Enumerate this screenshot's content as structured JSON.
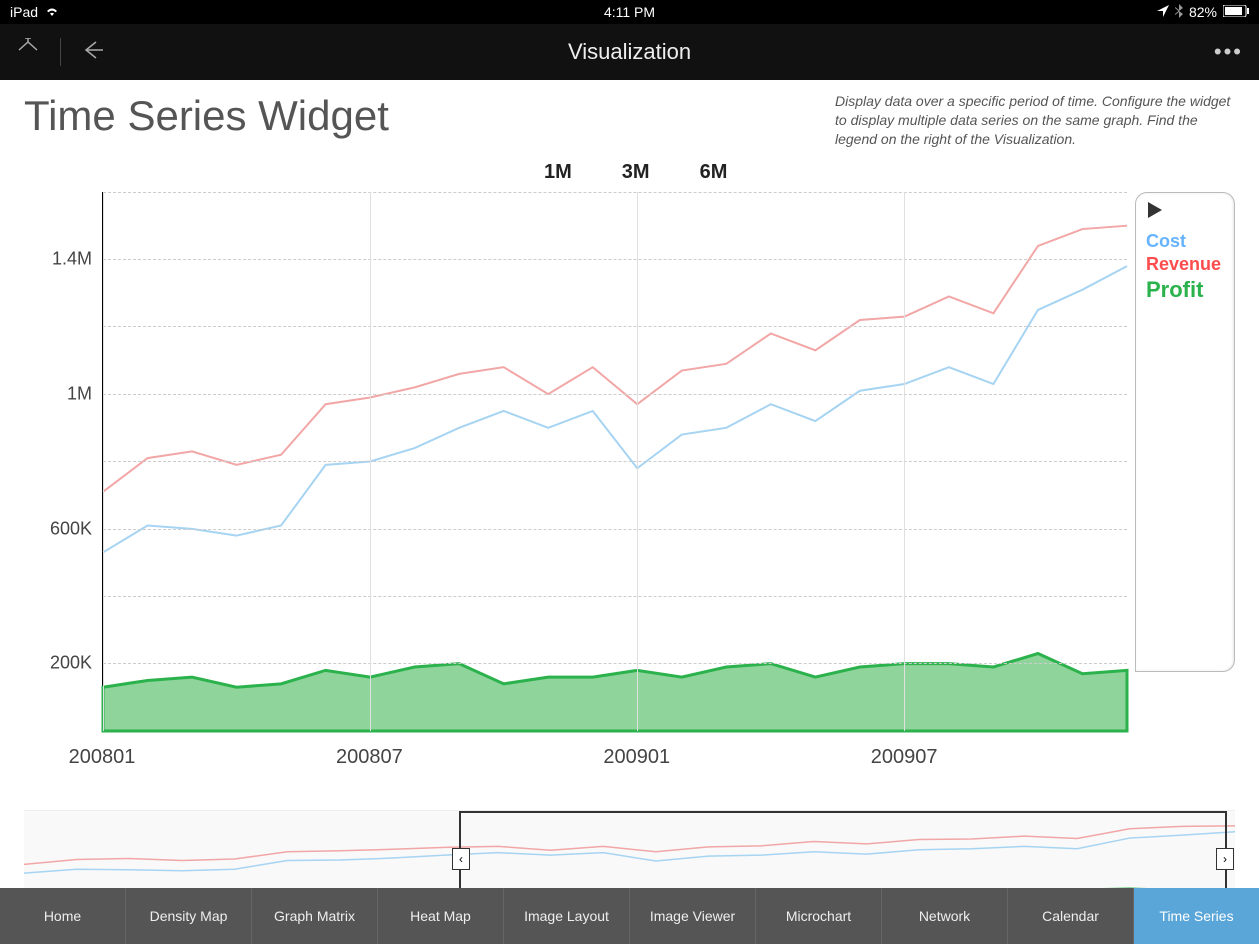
{
  "status": {
    "device": "iPad",
    "time": "4:11 PM",
    "battery": "82%"
  },
  "nav": {
    "title": "Visualization"
  },
  "page": {
    "title": "Time Series Widget",
    "description": "Display data over a specific period of time. Configure the widget to display multiple data series on the same graph. Find the legend on the right of the Visualization."
  },
  "ranges": [
    "1M",
    "3M",
    "6M"
  ],
  "legend": {
    "cost": "Cost",
    "revenue": "Revenue",
    "profit": "Profit"
  },
  "tabs": [
    "Home",
    "Density Map",
    "Graph Matrix",
    "Heat Map",
    "Image Layout",
    "Image Viewer",
    "Microchart",
    "Network",
    "Calendar",
    "Time Series"
  ],
  "active_tab": "Time Series",
  "chart_data": {
    "type": "line",
    "title": "Time Series Widget",
    "xlabel": "",
    "ylabel": "",
    "y_ticks": [
      "200K",
      "600K",
      "1M",
      "1.4M"
    ],
    "x_ticks": [
      "200801",
      "200807",
      "200901",
      "200907"
    ],
    "ylim": [
      0,
      1600000
    ],
    "x": [
      "200801",
      "200802",
      "200803",
      "200804",
      "200805",
      "200806",
      "200807",
      "200808",
      "200809",
      "200810",
      "200811",
      "200812",
      "200901",
      "200902",
      "200903",
      "200904",
      "200905",
      "200906",
      "200907",
      "200908",
      "200909",
      "200910",
      "200911",
      "200912"
    ],
    "series": [
      {
        "name": "Cost",
        "color": "#66b3ff",
        "type": "line",
        "values": [
          530000,
          610000,
          600000,
          580000,
          610000,
          790000,
          800000,
          840000,
          900000,
          950000,
          900000,
          950000,
          780000,
          880000,
          900000,
          970000,
          920000,
          1010000,
          1030000,
          1080000,
          1030000,
          1250000,
          1310000,
          1380000
        ]
      },
      {
        "name": "Revenue",
        "color": "#ff4d4d",
        "type": "line",
        "values": [
          710000,
          810000,
          830000,
          790000,
          820000,
          970000,
          990000,
          1020000,
          1060000,
          1080000,
          1000000,
          1080000,
          970000,
          1070000,
          1090000,
          1180000,
          1130000,
          1220000,
          1230000,
          1290000,
          1240000,
          1440000,
          1490000,
          1500000
        ]
      },
      {
        "name": "Profit",
        "color": "#2bb24c",
        "type": "area",
        "values": [
          130000,
          150000,
          160000,
          130000,
          140000,
          180000,
          160000,
          190000,
          200000,
          140000,
          160000,
          160000,
          180000,
          160000,
          190000,
          200000,
          160000,
          190000,
          200000,
          200000,
          190000,
          230000,
          170000,
          180000
        ]
      }
    ]
  }
}
